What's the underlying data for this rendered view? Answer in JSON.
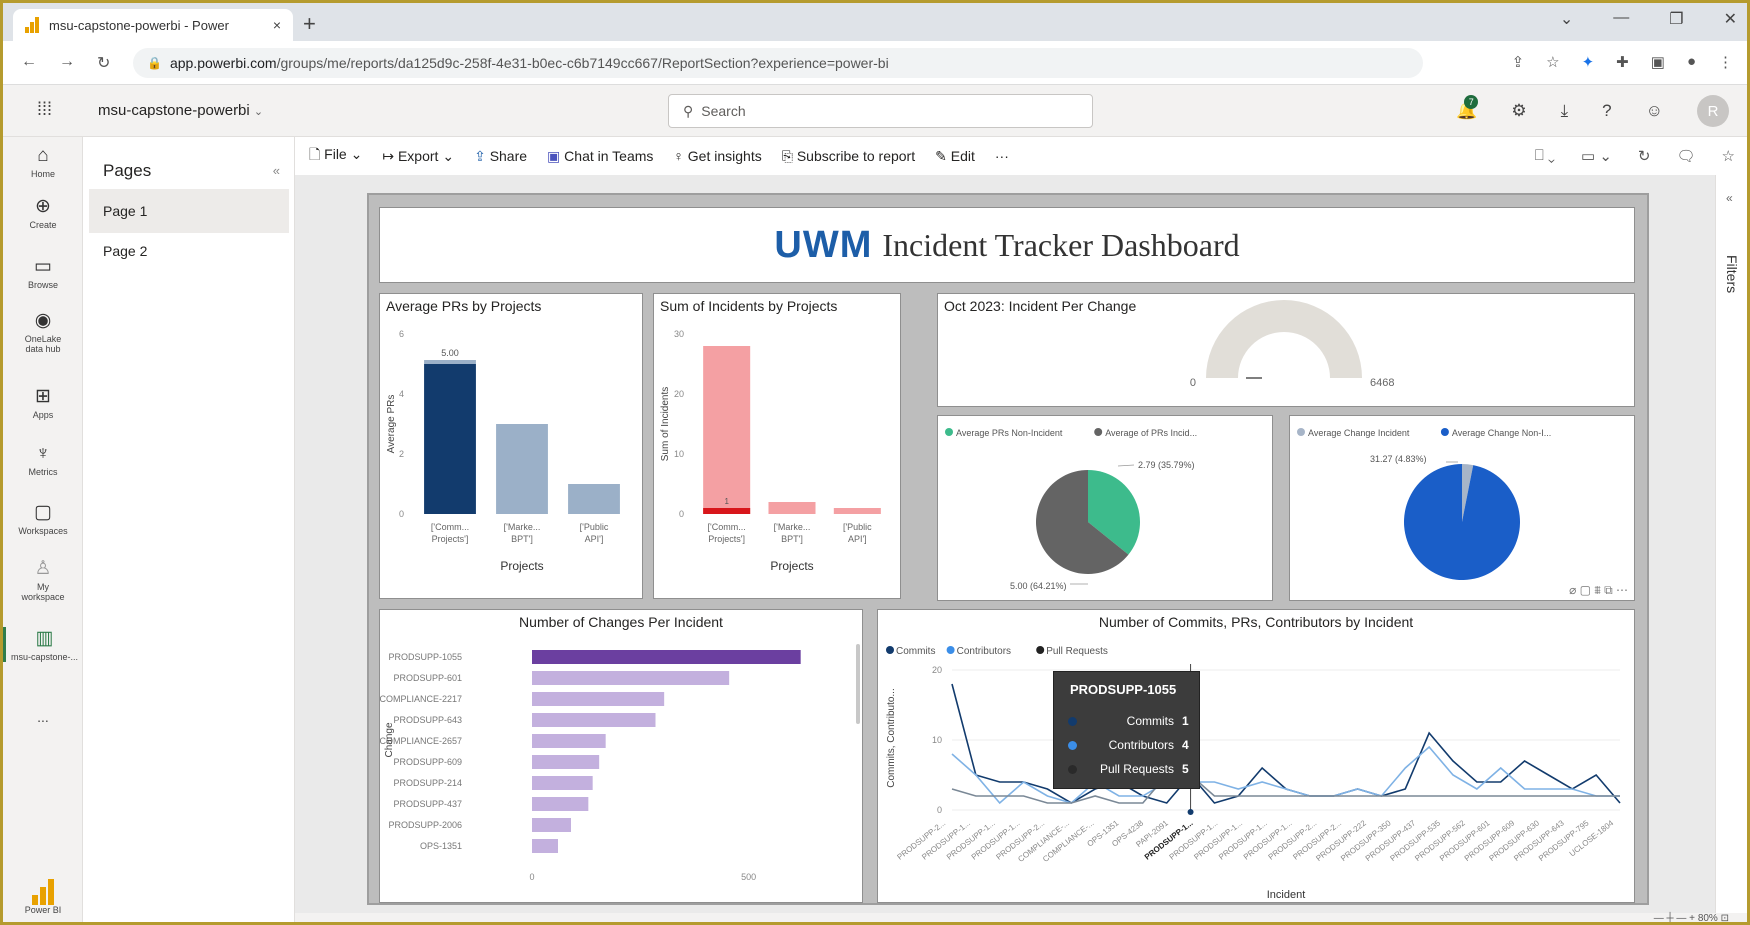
{
  "browser": {
    "tab_title": "msu-capstone-powerbi - Power",
    "tab_close": "×",
    "new_tab": "+",
    "url_host": "app.powerbi.com",
    "url_path": "/groups/me/reports/da125d9c-258f-4e31-b0ec-c6b7149cc667/ReportSection?experience=power-bi"
  },
  "header": {
    "workspace": "msu-capstone-powerbi",
    "search_placeholder": "Search",
    "notification_count": "7",
    "avatar_initial": "R"
  },
  "rail": [
    {
      "label": "Home",
      "icon": "home-icon"
    },
    {
      "label": "Create",
      "icon": "plus-circle-icon"
    },
    {
      "label": "Browse",
      "icon": "folder-icon"
    },
    {
      "label": "OneLake data hub",
      "icon": "onelake-icon"
    },
    {
      "label": "Apps",
      "icon": "apps-icon"
    },
    {
      "label": "Metrics",
      "icon": "trophy-icon"
    },
    {
      "label": "Workspaces",
      "icon": "workspaces-icon"
    },
    {
      "label": "My workspace",
      "icon": "person-icon"
    },
    {
      "label": "msu-capstone-...",
      "icon": "report-icon"
    },
    {
      "label": "...",
      "icon": "more-icon"
    }
  ],
  "pages": {
    "title": "Pages",
    "collapse": "«",
    "items": [
      "Page 1",
      "Page 2"
    ]
  },
  "toolbar": {
    "file": "File",
    "export": "Export",
    "share": "Share",
    "chat": "Chat in Teams",
    "insights": "Get insights",
    "subscribe": "Subscribe to report",
    "edit": "Edit",
    "more": "···"
  },
  "filters_label": "Filters",
  "report": {
    "brand": "UWM",
    "title": "Incident Tracker Dashboard"
  },
  "tooltip": {
    "title": "PRODSUPP-1055",
    "rows": [
      {
        "label": "Commits",
        "value": "1"
      },
      {
        "label": "Contributors",
        "value": "4"
      },
      {
        "label": "Pull Requests",
        "value": "5"
      }
    ]
  },
  "footer": {
    "app": "Power BI",
    "zoom": "80%"
  },
  "colors": {
    "accent": "#1d5ea8",
    "navy": "#123b6d",
    "steel": "#9bb0c8",
    "pink": "#f4a0a3",
    "red": "#d8161b",
    "green": "#3dbb8c",
    "gray": "#646464",
    "blue": "#1a5ec8",
    "purple": "#6b3fa0",
    "lavender": "#c3b0de"
  },
  "chart_data": [
    {
      "type": "bar",
      "title": "Average PRs by Projects",
      "categories": [
        "['Comm... Projects']",
        "['Marke... BPT']",
        "['Public API']"
      ],
      "values": [
        5.0,
        3.0,
        1.0
      ],
      "xlabel": "Projects",
      "ylabel": "Average PRs",
      "ylim": [
        0,
        6
      ],
      "yticks": [
        0,
        2,
        4,
        6
      ],
      "data_labels": [
        "5.00"
      ]
    },
    {
      "type": "bar",
      "title": "Sum of Incidents by Projects",
      "categories": [
        "['Comm... Projects']",
        "['Marke... BPT']",
        "['Public API']"
      ],
      "values": [
        28,
        2,
        1
      ],
      "highlight": [
        1,
        0,
        0
      ],
      "highlight_label": "1",
      "xlabel": "Projects",
      "ylabel": "Sum of Incidents",
      "ylim": [
        0,
        30
      ],
      "yticks": [
        0,
        10,
        20,
        30
      ]
    },
    {
      "type": "gauge",
      "title": "Oct 2023: Incident Per Change",
      "min": 0,
      "max": 6468,
      "min_label": "0",
      "max_label": "6468",
      "value": 1
    },
    {
      "type": "pie",
      "legend": [
        "Average PRs Non-Incident",
        "Average of PRs Incid..."
      ],
      "values": [
        2.79,
        5.0
      ],
      "labels": [
        "2.79 (35.79%)",
        "5.00 (64.21%)"
      ]
    },
    {
      "type": "pie",
      "legend": [
        "Average Change Incident",
        "Average Change Non-I..."
      ],
      "values": [
        1,
        31.27
      ],
      "labels": [
        "31.27 (4.83%)"
      ]
    },
    {
      "type": "bar",
      "orientation": "horizontal",
      "title": "Number of Changes Per Incident",
      "categories": [
        "PRODSUPP-1055",
        "PRODSUPP-601",
        "COMPLIANCE-2217",
        "PRODSUPP-643",
        "COMPLIANCE-2657",
        "PRODSUPP-609",
        "PRODSUPP-214",
        "PRODSUPP-437",
        "PRODSUPP-2006",
        "OPS-1351"
      ],
      "values": [
        620,
        455,
        305,
        285,
        170,
        155,
        140,
        130,
        90,
        60
      ],
      "ylabel": "Change",
      "xticks": [
        0,
        500
      ],
      "xlim": [
        0,
        600
      ]
    },
    {
      "type": "line",
      "title": "Number of Commits, PRs, Contributors by Incident",
      "xlabel": "Incident",
      "ylabel": "Commits, Contributo...",
      "ylim": [
        0,
        20
      ],
      "yticks": [
        0,
        10,
        20
      ],
      "x": [
        "PRODSUPP-2...",
        "PRODSUPP-1...",
        "PRODSUPP-1...",
        "PRODSUPP-1...",
        "PRODSUPP-2...",
        "COMPLIANCE-...",
        "COMPLIANCE-...",
        "OPS-1351",
        "OPS-4238",
        "PAPI-2091",
        "PRODSUPP-1...",
        "PRODSUPP-1...",
        "PRODSUPP-1...",
        "PRODSUPP-1...",
        "PRODSUPP-1...",
        "PRODSUPP-2...",
        "PRODSUPP-2...",
        "PRODSUPP-222",
        "PRODSUPP-350",
        "PRODSUPP-437",
        "PRODSUPP-535",
        "PRODSUPP-562",
        "PRODSUPP-601",
        "PRODSUPP-609",
        "PRODSUPP-630",
        "PRODSUPP-643",
        "PRODSUPP-795",
        "UCLOSE-1804"
      ],
      "series": [
        {
          "name": "Commits",
          "values": [
            18,
            5,
            4,
            4,
            3,
            1,
            3,
            4,
            2,
            1,
            5,
            1,
            2,
            6,
            3,
            2,
            2,
            3,
            2,
            3,
            11,
            7,
            4,
            4,
            7,
            5,
            3,
            5,
            1
          ]
        },
        {
          "name": "Contributors",
          "values": [
            8,
            5,
            1,
            4,
            2,
            1,
            4,
            2,
            2,
            4,
            4,
            4,
            3,
            4,
            3,
            2,
            2,
            3,
            2,
            6,
            9,
            5,
            3,
            6,
            3,
            3,
            3,
            2,
            2
          ]
        },
        {
          "name": "Pull Requests",
          "values": [
            3,
            2,
            2,
            2,
            1,
            1,
            2,
            1,
            1,
            5,
            5,
            2,
            2,
            2,
            2,
            2,
            2,
            2,
            2,
            2,
            2,
            2,
            2,
            2,
            2,
            2,
            2,
            2,
            2
          ]
        }
      ]
    }
  ]
}
